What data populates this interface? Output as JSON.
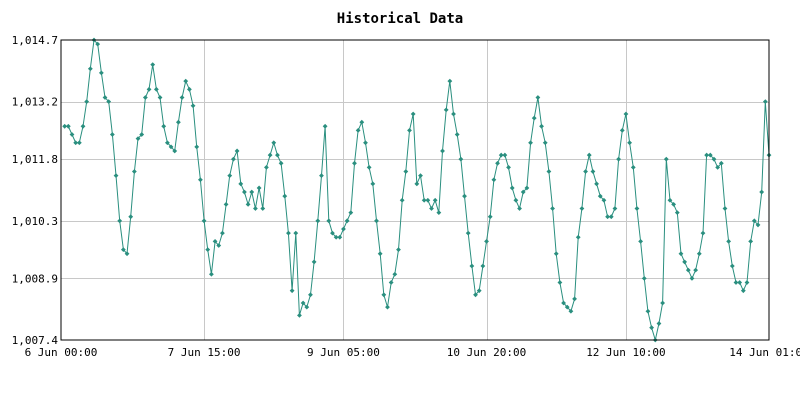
{
  "chart_data": {
    "type": "line",
    "title": "Historical Data",
    "xlabel": "",
    "ylabel": "",
    "x_range": [
      "6 Jun 00:00",
      "14 Jun 01:00"
    ],
    "x_ticks": [
      {
        "label": "6 Jun 00:00",
        "hours": 0
      },
      {
        "label": "7 Jun 15:00",
        "hours": 39
      },
      {
        "label": "9 Jun 05:00",
        "hours": 77
      },
      {
        "label": "10 Jun 20:00",
        "hours": 116
      },
      {
        "label": "12 Jun 10:00",
        "hours": 154
      },
      {
        "label": "14 Jun 01:00",
        "hours": 193
      }
    ],
    "ylim": [
      1007.4,
      1014.7
    ],
    "y_ticks": [
      "1,007.4",
      "1,008.9",
      "1,010.3",
      "1,011.8",
      "1,013.2",
      "1,014.7"
    ],
    "y_tick_values": [
      1007.4,
      1008.9,
      1010.3,
      1011.8,
      1013.2,
      1014.7
    ],
    "grid": true,
    "line_color": "#2a8f7f",
    "series": [
      {
        "time_hours_from_6_jun_00": 1,
        "values": [
          1012.6,
          1012.6,
          1012.4,
          1012.2,
          1012.2,
          1012.6,
          1013.2,
          1014.0,
          1014.7,
          1014.6,
          1013.9,
          1013.3,
          1013.2,
          1012.4,
          1011.4,
          1010.3,
          1009.6,
          1009.5,
          1010.4,
          1011.5,
          1012.3,
          1012.4,
          1013.3,
          1013.5,
          1014.1,
          1013.5,
          1013.3,
          1012.6,
          1012.2,
          1012.1,
          1012.0,
          1012.7,
          1013.3,
          1013.7,
          1013.5,
          1013.1,
          1012.1,
          1011.3,
          1010.3,
          1009.6,
          1009.0,
          1009.8,
          1009.7,
          1010.0,
          1010.7,
          1011.4,
          1011.8,
          1012.0,
          1011.2,
          1011.0,
          1010.7,
          1011.0,
          1010.6,
          1011.1,
          1010.6,
          1011.6,
          1011.9,
          1012.2,
          1011.9,
          1011.7,
          1010.9,
          1010.0,
          1008.6,
          1010.0,
          1008.0,
          1008.3,
          1008.2,
          1008.5,
          1009.3,
          1010.3,
          1011.4,
          1012.6,
          1010.3,
          1010.0,
          1009.9,
          1009.9,
          1010.1,
          1010.3,
          1010.5,
          1011.7,
          1012.5,
          1012.7,
          1012.2,
          1011.6,
          1011.2,
          1010.3,
          1009.5,
          1008.5,
          1008.2,
          1008.8,
          1009.0,
          1009.6,
          1010.8,
          1011.5,
          1012.5,
          1012.9,
          1011.2,
          1011.4,
          1010.8,
          1010.8,
          1010.6,
          1010.8,
          1010.5,
          1012.0,
          1013.0,
          1013.7,
          1012.9,
          1012.4,
          1011.8,
          1010.9,
          1010.0,
          1009.2,
          1008.5,
          1008.6,
          1009.2,
          1009.8,
          1010.4,
          1011.3,
          1011.7,
          1011.9,
          1011.9,
          1011.6,
          1011.1,
          1010.8,
          1010.6,
          1011.0,
          1011.1,
          1012.2,
          1012.8,
          1013.3,
          1012.6,
          1012.2,
          1011.5,
          1010.6,
          1009.5,
          1008.8,
          1008.3,
          1008.2,
          1008.1,
          1008.4,
          1009.9,
          1010.6,
          1011.5,
          1011.9,
          1011.5,
          1011.2,
          1010.9,
          1010.8,
          1010.4,
          1010.4,
          1010.6,
          1011.8,
          1012.5,
          1012.9,
          1012.2,
          1011.6,
          1010.6,
          1009.8,
          1008.9,
          1008.1,
          1007.7,
          1007.4,
          1007.8,
          1008.3,
          1011.8,
          1010.8,
          1010.7,
          1010.5,
          1009.5,
          1009.3,
          1009.1,
          1008.9,
          1009.1,
          1009.5,
          1010.0,
          1011.9,
          1011.9,
          1011.8,
          1011.6,
          1011.7,
          1010.6,
          1009.8,
          1009.2,
          1008.8,
          1008.8,
          1008.6,
          1008.8,
          1009.8,
          1010.3,
          1010.2,
          1011.0,
          1013.2,
          1011.9
        ]
      }
    ]
  }
}
